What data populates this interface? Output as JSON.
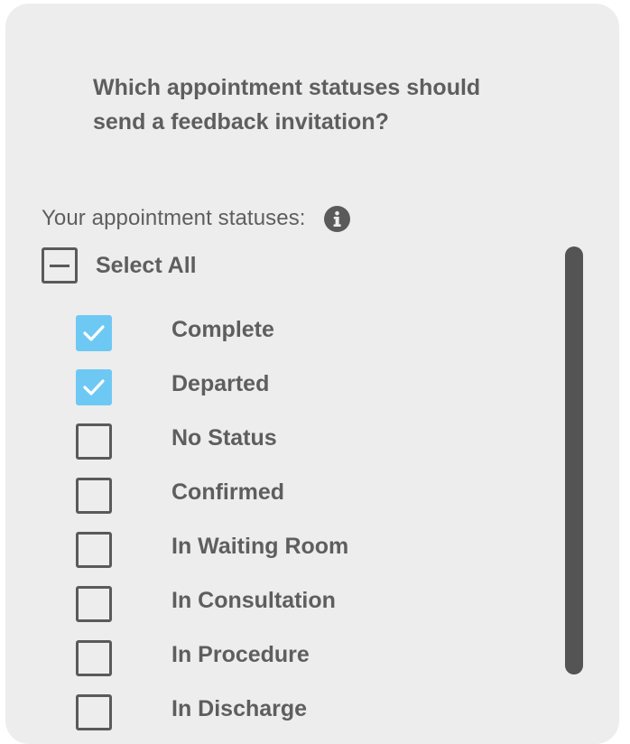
{
  "question": {
    "line1": "Which appointment statuses should",
    "line2": "send a feedback invitation?"
  },
  "statuses_label": "Your appointment statuses:",
  "info_icon": "info-circle-icon",
  "select_all": {
    "label": "Select All",
    "state": "indeterminate"
  },
  "statuses": [
    {
      "label": "Complete",
      "checked": true
    },
    {
      "label": "Departed",
      "checked": true
    },
    {
      "label": "No Status",
      "checked": false
    },
    {
      "label": "Confirmed",
      "checked": false
    },
    {
      "label": "In Waiting Room",
      "checked": false
    },
    {
      "label": "In Consultation",
      "checked": false
    },
    {
      "label": "In Procedure",
      "checked": false
    },
    {
      "label": "In Discharge",
      "checked": false
    }
  ],
  "colors": {
    "checked": "#6ec8f4",
    "text": "#5e5e5e",
    "panel": "#ededed"
  }
}
